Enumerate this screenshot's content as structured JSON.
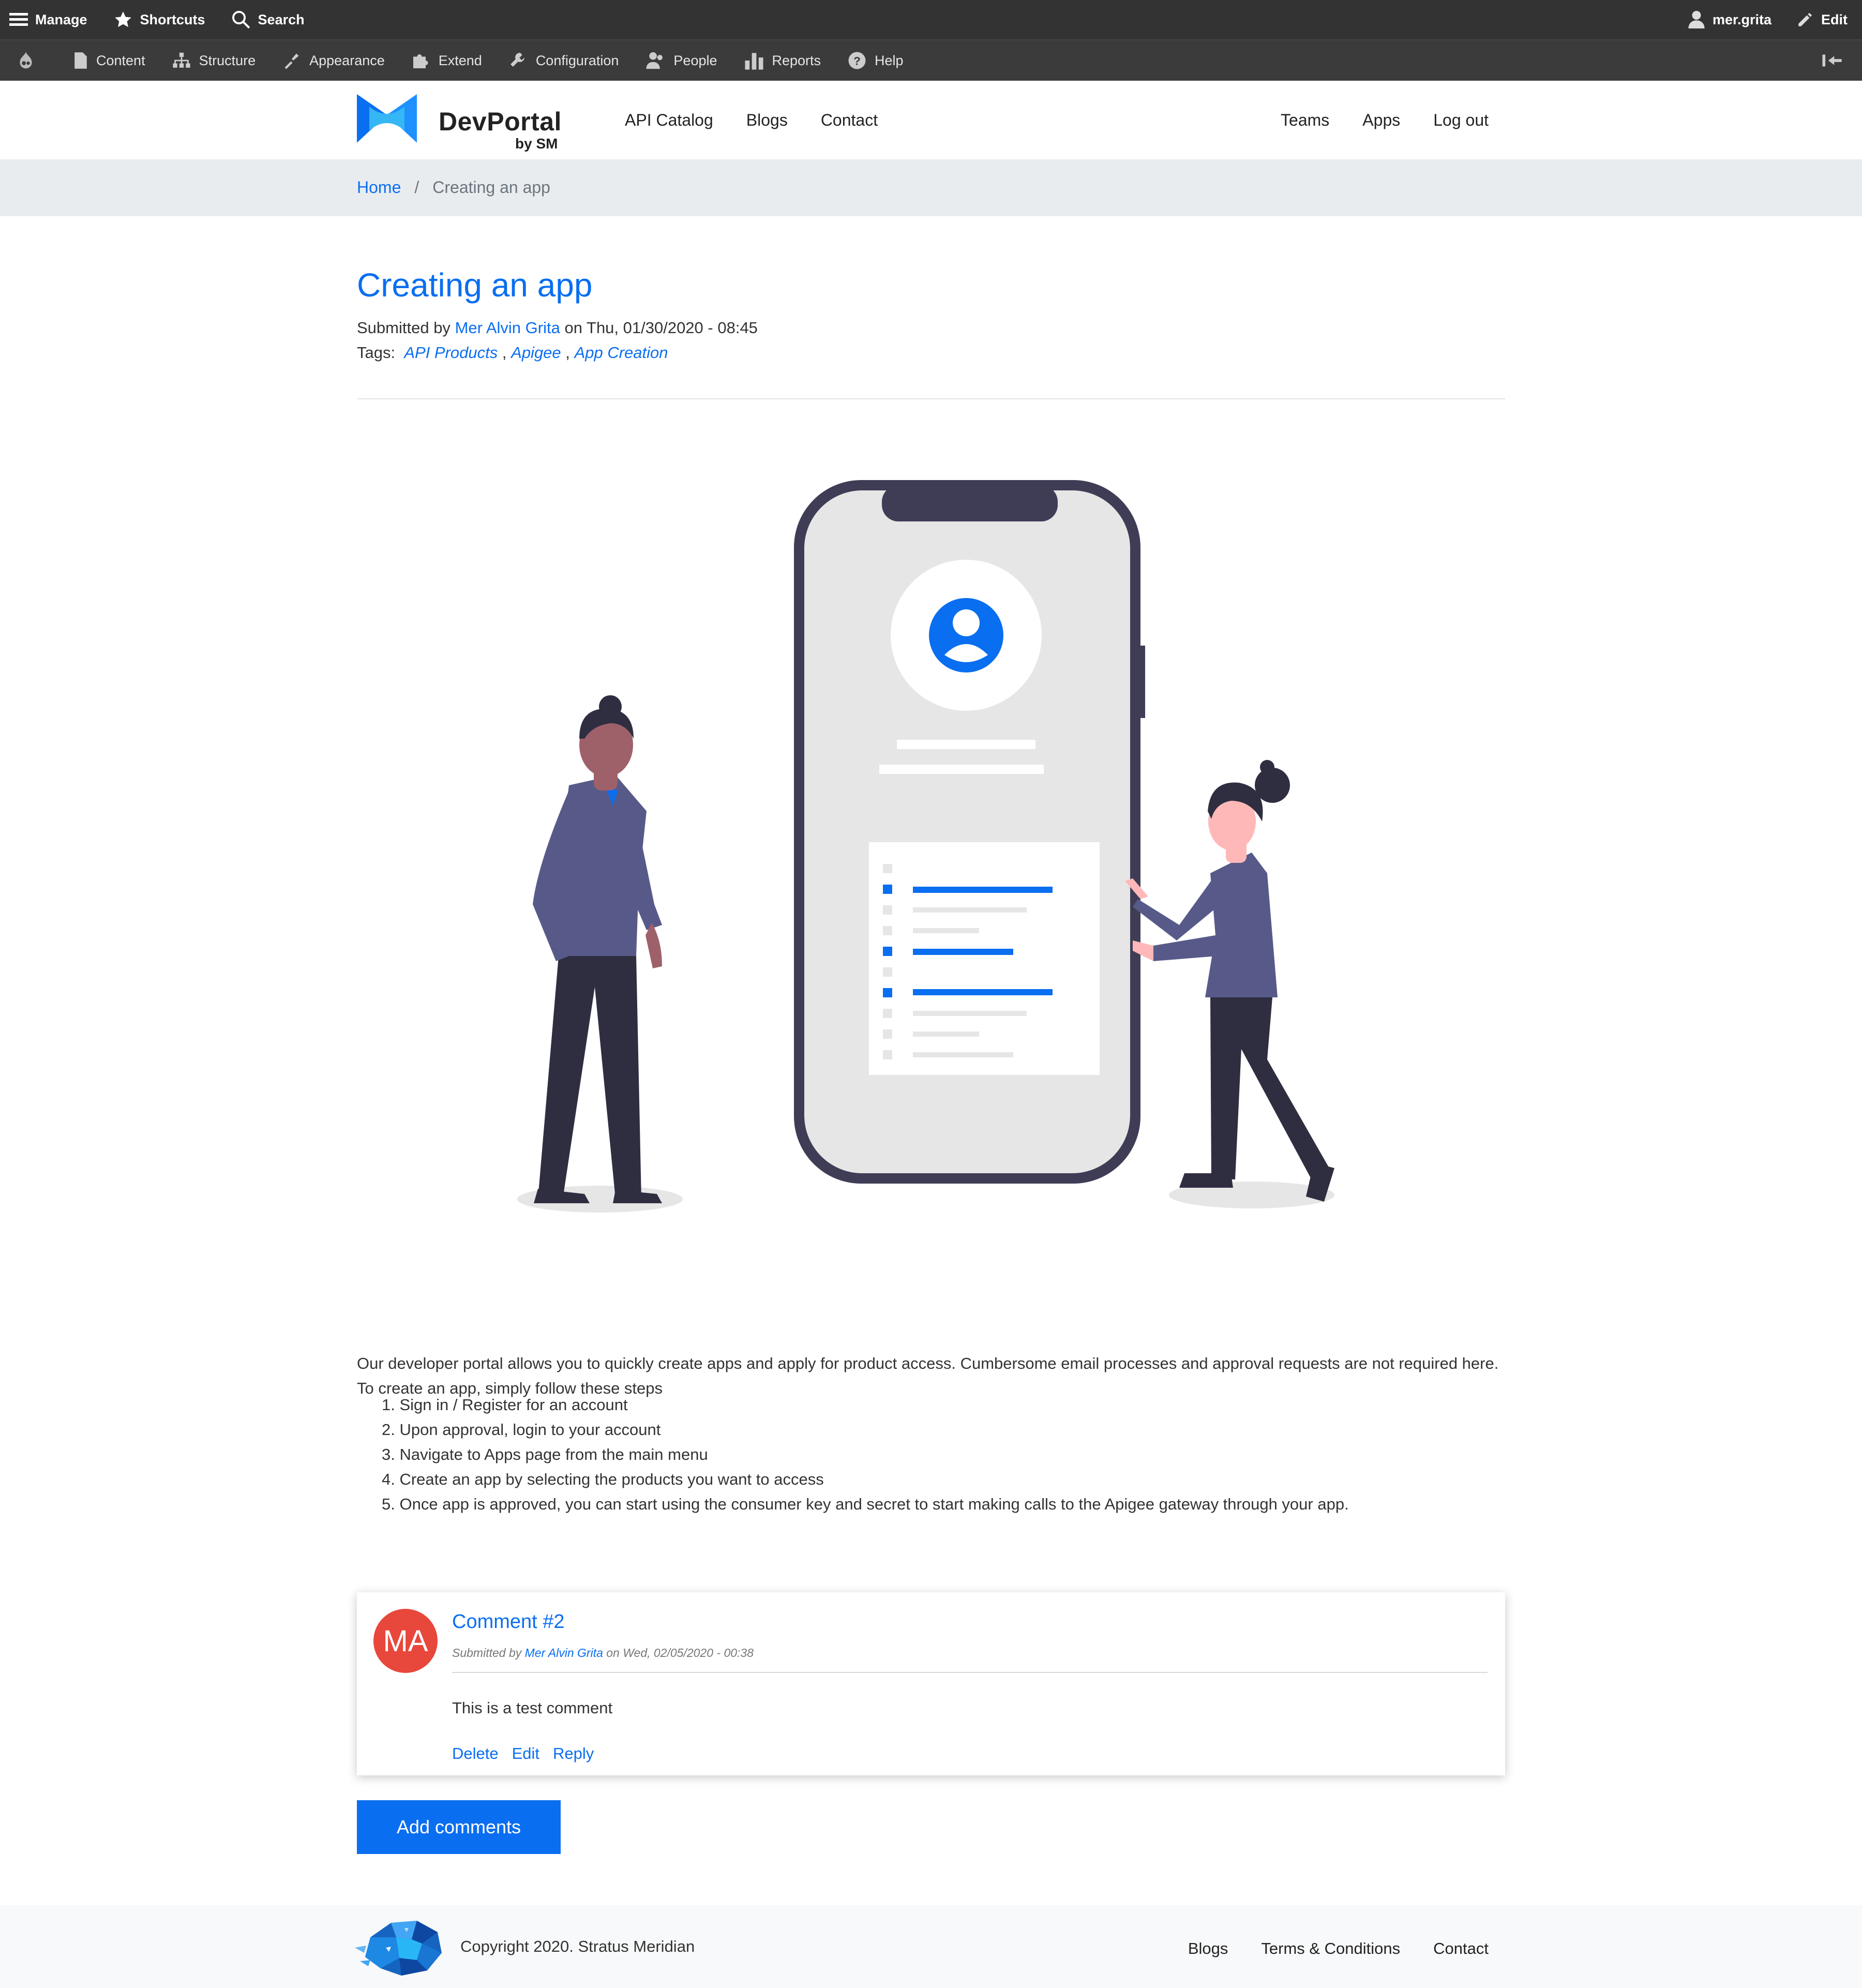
{
  "admin_toolbar": {
    "manage": "Manage",
    "shortcuts": "Shortcuts",
    "search": "Search",
    "user": "mer.grita",
    "edit": "Edit",
    "tray": [
      "Content",
      "Structure",
      "Appearance",
      "Extend",
      "Configuration",
      "People",
      "Reports",
      "Help"
    ]
  },
  "site": {
    "logo_name": "DevPortal",
    "logo_sub": "by SM",
    "main_nav": [
      "API Catalog",
      "Blogs",
      "Contact"
    ],
    "user_nav": [
      "Teams",
      "Apps",
      "Log out"
    ]
  },
  "breadcrumb": {
    "home": "Home",
    "sep": "/",
    "current": "Creating an app"
  },
  "article": {
    "title": "Creating an app",
    "submitted_by": "Submitted by",
    "author": "Mer Alvin Grita",
    "date_text": "on Thu, 01/30/2020 - 08:45",
    "tags_label": "Tags:",
    "tags": [
      "API Products",
      "Apigee",
      "App Creation"
    ],
    "tag_sep": ",",
    "intro": "Our developer portal allows you to quickly create apps and apply for product access. Cumbersome email processes and approval requests are not required here. To create an app, simply follow these steps",
    "steps": [
      "1. Sign in / Register for an account",
      "2. Upon approval, login to your account",
      "3. Navigate to Apps page from the main menu",
      "4. Create an app by selecting the products you want to access",
      "5. Once app is approved, you can start using the consumer key and secret to start making calls to the Apigee gateway through your app."
    ]
  },
  "comment": {
    "avatar_initials": "MA",
    "title": "Comment #2",
    "submitted_by": "Submitted by",
    "author": "Mer Alvin Grita",
    "date_text": "on Wed, 02/05/2020 - 00:38",
    "body": "This is a test comment",
    "actions": [
      "Delete",
      "Edit",
      "Reply"
    ]
  },
  "add_comments_label": "Add comments",
  "footer": {
    "copyright": "Copyright 2020. Stratus Meridian",
    "nav": [
      "Blogs",
      "Terms & Conditions",
      "Contact"
    ]
  },
  "colors": {
    "accent": "#0a6ef0",
    "toolbar": "#333333",
    "avatar": "#e8473b"
  }
}
